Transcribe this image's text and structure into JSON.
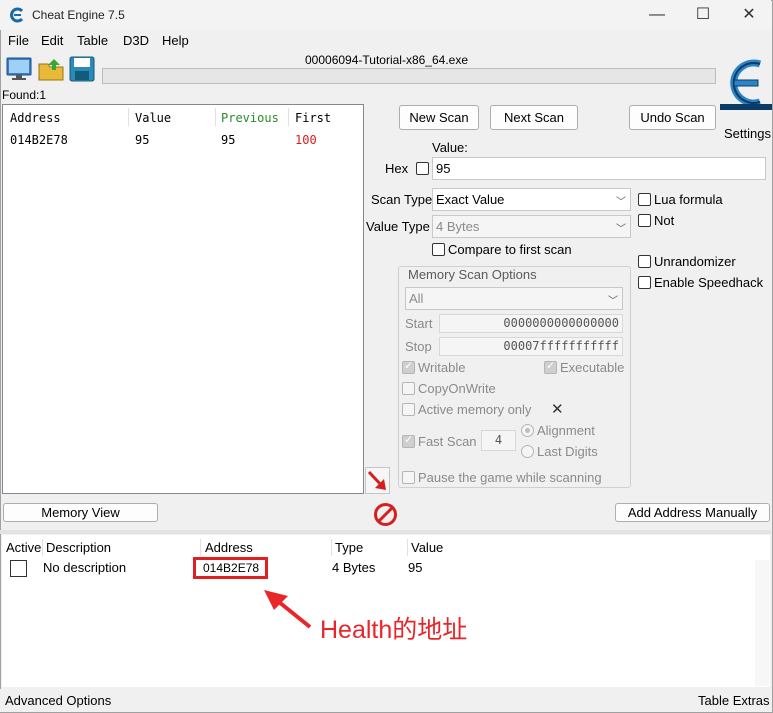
{
  "window": {
    "title": "Cheat Engine 7.5",
    "process_name": "00006094-Tutorial-x86_64.exe",
    "controls": {
      "minimize": "—",
      "maximize": "☐",
      "close": "✕"
    }
  },
  "menu": [
    "File",
    "Edit",
    "Table",
    "D3D",
    "Help"
  ],
  "toolbar": {
    "icons": [
      "open-process-icon",
      "open-file-icon",
      "save-icon"
    ],
    "settings_label": "Settings",
    "logo_icon": "cheat-engine-logo"
  },
  "found": {
    "label": "Found:",
    "count": "1"
  },
  "found_list": {
    "columns": [
      "Address",
      "Value",
      "Previous",
      "First"
    ],
    "rows": [
      {
        "address": "014B2E78",
        "value": "95",
        "previous": "95",
        "first": "100"
      }
    ]
  },
  "buttons": {
    "new_scan": "New Scan",
    "next_scan": "Next Scan",
    "undo_scan": "Undo Scan",
    "memory_view": "Memory View",
    "add_address_manually": "Add Address Manually"
  },
  "value": {
    "label": "Value:",
    "hex_label": "Hex",
    "input": "95"
  },
  "scan_type": {
    "label": "Scan Type",
    "selected": "Exact Value"
  },
  "value_type": {
    "label": "Value Type",
    "selected": "4 Bytes"
  },
  "options": {
    "compare_first": "Compare to first scan",
    "lua_formula": "Lua formula",
    "not": "Not",
    "unrandomizer": "Unrandomizer",
    "enable_speedhack": "Enable Speedhack"
  },
  "memory_scan": {
    "title": "Memory Scan Options",
    "region": "All",
    "start_label": "Start",
    "start_value": "0000000000000000",
    "stop_label": "Stop",
    "stop_value": "00007fffffffffff",
    "writable": "Writable",
    "executable": "Executable",
    "copy_on_write": "CopyOnWrite",
    "active_memory_only": "Active memory only",
    "fast_scan": "Fast Scan",
    "fast_scan_value": "4",
    "alignment": "Alignment",
    "last_digits": "Last Digits",
    "pause_game": "Pause the game while scanning"
  },
  "address_table": {
    "columns": [
      "Active",
      "Description",
      "Address",
      "Type",
      "Value"
    ],
    "rows": [
      {
        "description": "No description",
        "address": "014B2E78",
        "type": "4 Bytes",
        "value": "95"
      }
    ]
  },
  "status": {
    "left": "Advanced Options",
    "right": "Table Extras"
  },
  "annotation": {
    "text": "Health的地址",
    "color": "#e8262a"
  },
  "colors": {
    "previous_header": "#2a8a2a",
    "first_value": "#d42020",
    "highlight": "#e02020"
  }
}
